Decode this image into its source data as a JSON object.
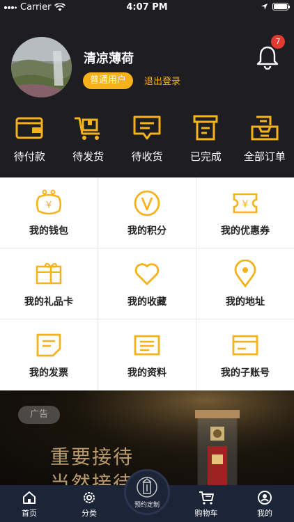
{
  "status_bar": {
    "carrier": "Carrier",
    "time": "4:07 PM"
  },
  "profile": {
    "username": "清凉薄荷",
    "badge": "普通用户",
    "logout": "退出登录",
    "notification_count": "7"
  },
  "orders": [
    {
      "label": "待付款",
      "icon": "wallet-icon"
    },
    {
      "label": "待发货",
      "icon": "cart-icon"
    },
    {
      "label": "待收货",
      "icon": "message-icon"
    },
    {
      "label": "已完成",
      "icon": "receipt-icon"
    },
    {
      "label": "全部订单",
      "icon": "inbox-icon"
    }
  ],
  "menu": [
    {
      "label": "我的钱包",
      "icon": "purse-icon"
    },
    {
      "label": "我的积分",
      "icon": "points-icon"
    },
    {
      "label": "我的优惠券",
      "icon": "coupon-icon"
    },
    {
      "label": "我的礼品卡",
      "icon": "gift-card-icon"
    },
    {
      "label": "我的收藏",
      "icon": "heart-icon"
    },
    {
      "label": "我的地址",
      "icon": "location-icon"
    },
    {
      "label": "我的发票",
      "icon": "invoice-icon"
    },
    {
      "label": "我的资料",
      "icon": "profile-card-icon"
    },
    {
      "label": "我的子账号",
      "icon": "sub-account-icon"
    }
  ],
  "ad": {
    "tag": "广告",
    "line1": "重要接待",
    "line2": "当然接待"
  },
  "tabbar": {
    "home": "首页",
    "category": "分类",
    "center": "预约定制",
    "cart": "购物车",
    "mine": "我的"
  },
  "colors": {
    "accent": "#f6b21b",
    "header_bg": "#1d1d22",
    "tabbar_bg": "#1c2438"
  }
}
